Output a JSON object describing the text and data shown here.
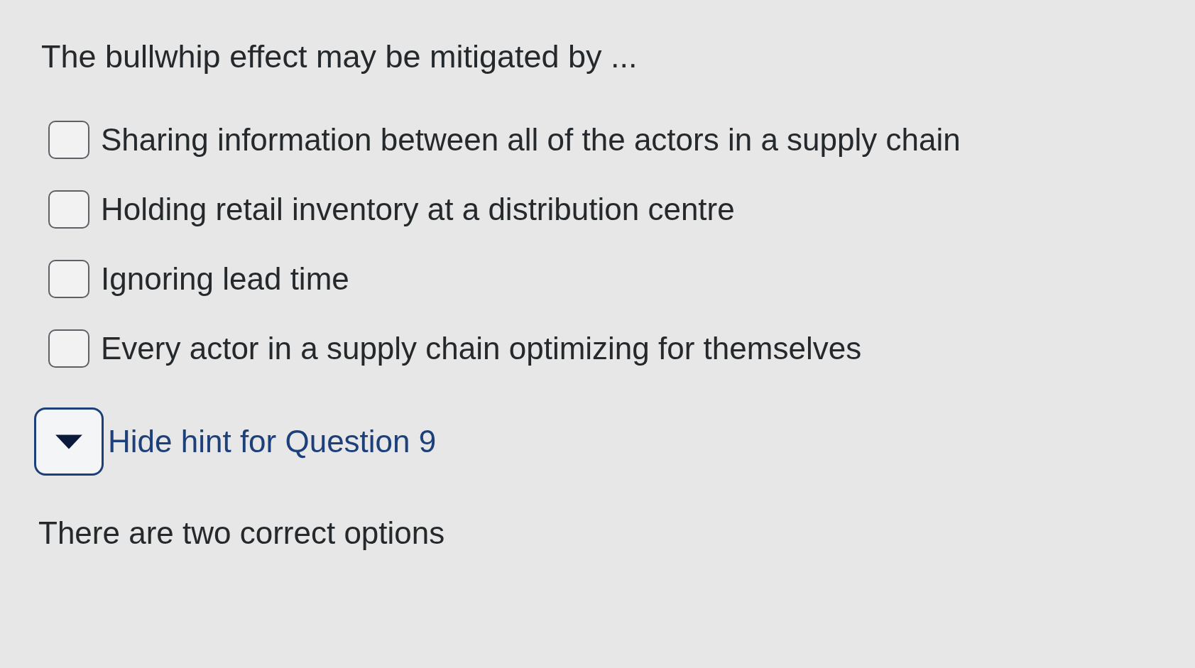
{
  "question": {
    "text": "The bullwhip effect may be mitigated by ..."
  },
  "options": [
    {
      "label": "Sharing information between all of the actors in a supply chain",
      "checked": false
    },
    {
      "label": "Holding retail inventory at a distribution centre",
      "checked": false
    },
    {
      "label": "Ignoring lead time",
      "checked": false
    },
    {
      "label": "Every actor in a supply chain optimizing for themselves",
      "checked": false
    }
  ],
  "hint": {
    "label": "Hide hint for Question 9",
    "expanded": true,
    "text": "There are two correct options"
  }
}
